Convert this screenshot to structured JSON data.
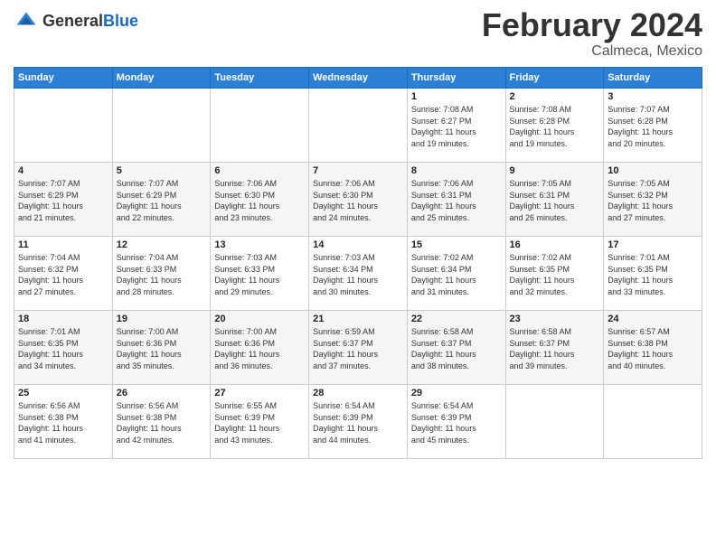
{
  "header": {
    "logo": {
      "general": "General",
      "blue": "Blue"
    },
    "month_title": "February 2024",
    "subtitle": "Calmeca, Mexico"
  },
  "calendar": {
    "weekdays": [
      "Sunday",
      "Monday",
      "Tuesday",
      "Wednesday",
      "Thursday",
      "Friday",
      "Saturday"
    ],
    "weeks": [
      [
        {
          "day": "",
          "info": ""
        },
        {
          "day": "",
          "info": ""
        },
        {
          "day": "",
          "info": ""
        },
        {
          "day": "",
          "info": ""
        },
        {
          "day": "1",
          "info": "Sunrise: 7:08 AM\nSunset: 6:27 PM\nDaylight: 11 hours\nand 19 minutes."
        },
        {
          "day": "2",
          "info": "Sunrise: 7:08 AM\nSunset: 6:28 PM\nDaylight: 11 hours\nand 19 minutes."
        },
        {
          "day": "3",
          "info": "Sunrise: 7:07 AM\nSunset: 6:28 PM\nDaylight: 11 hours\nand 20 minutes."
        }
      ],
      [
        {
          "day": "4",
          "info": "Sunrise: 7:07 AM\nSunset: 6:29 PM\nDaylight: 11 hours\nand 21 minutes."
        },
        {
          "day": "5",
          "info": "Sunrise: 7:07 AM\nSunset: 6:29 PM\nDaylight: 11 hours\nand 22 minutes."
        },
        {
          "day": "6",
          "info": "Sunrise: 7:06 AM\nSunset: 6:30 PM\nDaylight: 11 hours\nand 23 minutes."
        },
        {
          "day": "7",
          "info": "Sunrise: 7:06 AM\nSunset: 6:30 PM\nDaylight: 11 hours\nand 24 minutes."
        },
        {
          "day": "8",
          "info": "Sunrise: 7:06 AM\nSunset: 6:31 PM\nDaylight: 11 hours\nand 25 minutes."
        },
        {
          "day": "9",
          "info": "Sunrise: 7:05 AM\nSunset: 6:31 PM\nDaylight: 11 hours\nand 26 minutes."
        },
        {
          "day": "10",
          "info": "Sunrise: 7:05 AM\nSunset: 6:32 PM\nDaylight: 11 hours\nand 27 minutes."
        }
      ],
      [
        {
          "day": "11",
          "info": "Sunrise: 7:04 AM\nSunset: 6:32 PM\nDaylight: 11 hours\nand 27 minutes."
        },
        {
          "day": "12",
          "info": "Sunrise: 7:04 AM\nSunset: 6:33 PM\nDaylight: 11 hours\nand 28 minutes."
        },
        {
          "day": "13",
          "info": "Sunrise: 7:03 AM\nSunset: 6:33 PM\nDaylight: 11 hours\nand 29 minutes."
        },
        {
          "day": "14",
          "info": "Sunrise: 7:03 AM\nSunset: 6:34 PM\nDaylight: 11 hours\nand 30 minutes."
        },
        {
          "day": "15",
          "info": "Sunrise: 7:02 AM\nSunset: 6:34 PM\nDaylight: 11 hours\nand 31 minutes."
        },
        {
          "day": "16",
          "info": "Sunrise: 7:02 AM\nSunset: 6:35 PM\nDaylight: 11 hours\nand 32 minutes."
        },
        {
          "day": "17",
          "info": "Sunrise: 7:01 AM\nSunset: 6:35 PM\nDaylight: 11 hours\nand 33 minutes."
        }
      ],
      [
        {
          "day": "18",
          "info": "Sunrise: 7:01 AM\nSunset: 6:35 PM\nDaylight: 11 hours\nand 34 minutes."
        },
        {
          "day": "19",
          "info": "Sunrise: 7:00 AM\nSunset: 6:36 PM\nDaylight: 11 hours\nand 35 minutes."
        },
        {
          "day": "20",
          "info": "Sunrise: 7:00 AM\nSunset: 6:36 PM\nDaylight: 11 hours\nand 36 minutes."
        },
        {
          "day": "21",
          "info": "Sunrise: 6:59 AM\nSunset: 6:37 PM\nDaylight: 11 hours\nand 37 minutes."
        },
        {
          "day": "22",
          "info": "Sunrise: 6:58 AM\nSunset: 6:37 PM\nDaylight: 11 hours\nand 38 minutes."
        },
        {
          "day": "23",
          "info": "Sunrise: 6:58 AM\nSunset: 6:37 PM\nDaylight: 11 hours\nand 39 minutes."
        },
        {
          "day": "24",
          "info": "Sunrise: 6:57 AM\nSunset: 6:38 PM\nDaylight: 11 hours\nand 40 minutes."
        }
      ],
      [
        {
          "day": "25",
          "info": "Sunrise: 6:56 AM\nSunset: 6:38 PM\nDaylight: 11 hours\nand 41 minutes."
        },
        {
          "day": "26",
          "info": "Sunrise: 6:56 AM\nSunset: 6:38 PM\nDaylight: 11 hours\nand 42 minutes."
        },
        {
          "day": "27",
          "info": "Sunrise: 6:55 AM\nSunset: 6:39 PM\nDaylight: 11 hours\nand 43 minutes."
        },
        {
          "day": "28",
          "info": "Sunrise: 6:54 AM\nSunset: 6:39 PM\nDaylight: 11 hours\nand 44 minutes."
        },
        {
          "day": "29",
          "info": "Sunrise: 6:54 AM\nSunset: 6:39 PM\nDaylight: 11 hours\nand 45 minutes."
        },
        {
          "day": "",
          "info": ""
        },
        {
          "day": "",
          "info": ""
        }
      ]
    ]
  }
}
